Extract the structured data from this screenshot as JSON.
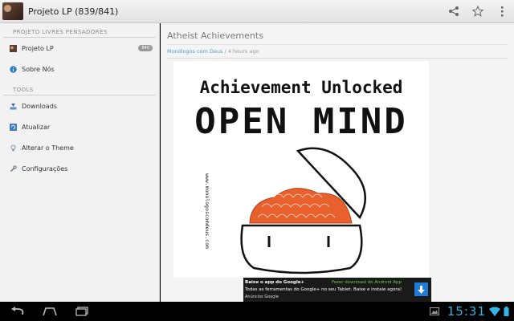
{
  "actionbar": {
    "title": "Projeto LP (839/841)",
    "actions": [
      {
        "icon": "share-icon"
      },
      {
        "icon": "star-icon"
      },
      {
        "icon": "overflow-menu-icon"
      }
    ]
  },
  "sidebar": {
    "section_feeds": "PROJETO LIVRES PENSADORES",
    "items": [
      {
        "label": "Projeto LP",
        "count": "840",
        "icon": "feed-avatar-icon"
      },
      {
        "label": "Sobre Nós",
        "icon": "info-icon"
      }
    ],
    "section_tools": "TOOLS",
    "tools": [
      {
        "label": "Downloads",
        "icon": "download-icon"
      },
      {
        "label": "Atualizar",
        "icon": "refresh-icon"
      },
      {
        "label": "Alterar o Theme",
        "icon": "bulb-icon"
      },
      {
        "label": "Configurações",
        "icon": "wrench-icon"
      }
    ]
  },
  "article": {
    "title": "Atheist Achievements",
    "source": "Monólogos com Deus",
    "separator": " / ",
    "time": "4 hours ago",
    "comic": {
      "line1": "Achievement Unlocked",
      "line2": "OPEN MIND",
      "side_text": "www.monologoscomdeus.com"
    }
  },
  "ad": {
    "title": "Baixe o app do Google+",
    "subtitle": "Fazer download do Android App",
    "body": "Todas as ferramentas do Google+ no seu Tablet. Baixe e instale agora!",
    "by": "Anúncios Google"
  },
  "system": {
    "clock": "15:31"
  },
  "colors": {
    "accent": "#33b5e5",
    "link": "#4aa3c9",
    "brain": "#e8602c"
  }
}
